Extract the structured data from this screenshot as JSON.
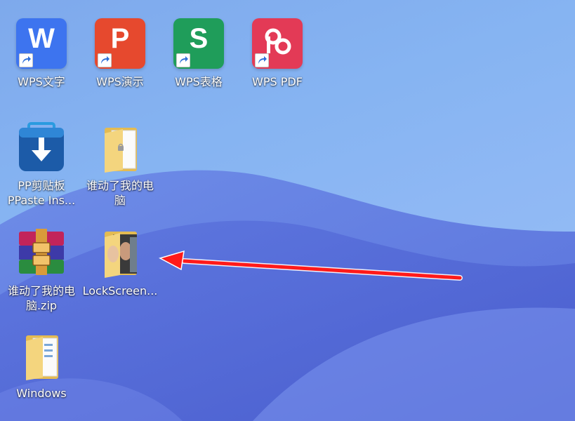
{
  "desktop": {
    "icons": [
      {
        "label": "WPS文字",
        "icon": "wps-writer-icon",
        "letter": "W",
        "color": "#3c73f0"
      },
      {
        "label": "WPS演示",
        "icon": "wps-presentation-icon",
        "letter": "P",
        "color": "#e8492f"
      },
      {
        "label": "WPS表格",
        "icon": "wps-spreadsheet-icon",
        "letter": "S",
        "color": "#1f9e5b"
      },
      {
        "label": "WPS PDF",
        "icon": "wps-pdf-icon",
        "letter": "",
        "color": "#e43a55"
      },
      {
        "label": "PP剪贴板\nPPaste Ins...",
        "icon": "download-installer-icon",
        "color": "#1f5fae"
      },
      {
        "label": "谁动了我的电\n脑",
        "icon": "folder-icon"
      },
      {
        "label": "谁动了我的电\n脑.zip",
        "icon": "winrar-archive-icon"
      },
      {
        "label": "LockScreen...",
        "icon": "folder-with-photos-icon"
      },
      {
        "label": "Windows",
        "icon": "folder-icon"
      }
    ],
    "annotation_arrow_color": "#ff1a1a"
  }
}
